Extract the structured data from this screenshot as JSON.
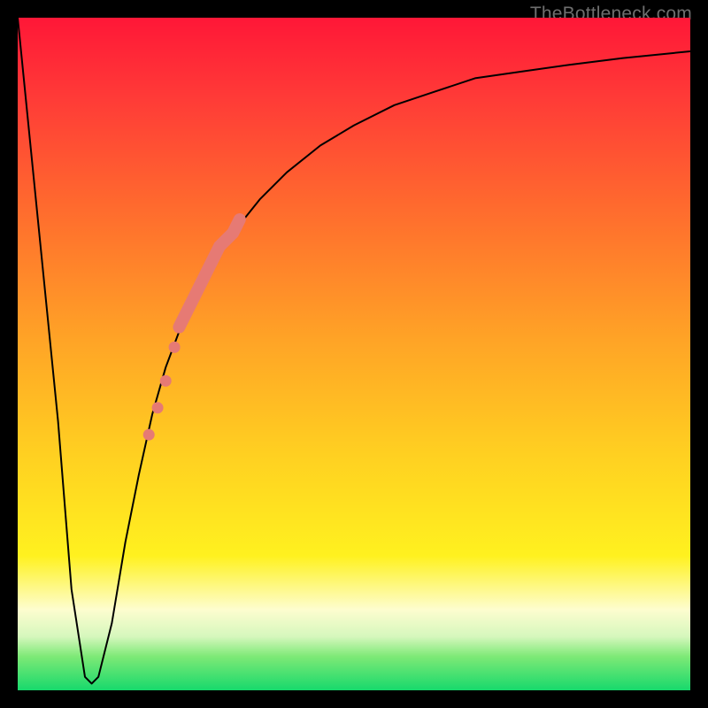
{
  "watermark": "TheBottleneck.com",
  "chart_data": {
    "type": "line",
    "title": "",
    "xlabel": "",
    "ylabel": "",
    "xlim": [
      0,
      100
    ],
    "ylim": [
      0,
      100
    ],
    "grid": false,
    "legend": false,
    "background_gradient": {
      "stops": [
        {
          "pos": 0.0,
          "color": "#ff1737"
        },
        {
          "pos": 0.12,
          "color": "#ff3b37"
        },
        {
          "pos": 0.28,
          "color": "#ff6a2e"
        },
        {
          "pos": 0.48,
          "color": "#ffa426"
        },
        {
          "pos": 0.65,
          "color": "#ffd021"
        },
        {
          "pos": 0.8,
          "color": "#fff11f"
        },
        {
          "pos": 0.88,
          "color": "#fdfdcf"
        },
        {
          "pos": 0.92,
          "color": "#d6f7bd"
        },
        {
          "pos": 0.95,
          "color": "#7de976"
        },
        {
          "pos": 1.0,
          "color": "#17d96c"
        }
      ]
    },
    "series": [
      {
        "name": "bottleneck-curve",
        "color": "#000000",
        "stroke_width": 2,
        "x": [
          0,
          3,
          6,
          8,
          10,
          11,
          12,
          14,
          16,
          18,
          20,
          22,
          25,
          28,
          32,
          36,
          40,
          45,
          50,
          56,
          62,
          68,
          75,
          82,
          90,
          100
        ],
        "y": [
          100,
          70,
          40,
          15,
          2,
          1,
          2,
          10,
          22,
          32,
          41,
          48,
          56,
          62,
          68,
          73,
          77,
          81,
          84,
          87,
          89,
          91,
          92,
          93,
          94,
          95
        ]
      }
    ],
    "highlight_segment": {
      "name": "thick-coral-overlay",
      "color": "#e67a74",
      "stroke_width": 14,
      "linecap": "round",
      "x": [
        24,
        25,
        26,
        28,
        30,
        32,
        33
      ],
      "y": [
        54,
        56,
        58,
        62,
        66,
        68,
        70
      ]
    },
    "highlight_points": {
      "name": "coral-dots",
      "color": "#e67a74",
      "radius": 6.5,
      "x": [
        19.5,
        20.8,
        22.0,
        23.3
      ],
      "y": [
        38,
        42,
        46,
        51
      ]
    }
  }
}
